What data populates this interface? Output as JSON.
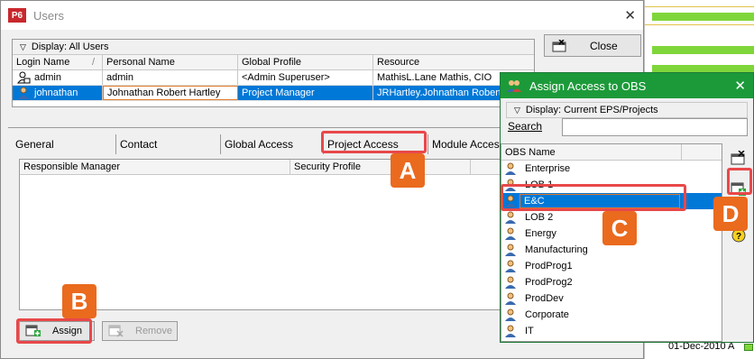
{
  "gantt": {
    "date": "01-Dec-2010 A"
  },
  "users": {
    "title": "Users",
    "app_logo": "P6",
    "close_label": "Close",
    "display_label": "Display: All Users",
    "columns": [
      "Login Name",
      "Personal Name",
      "Global Profile",
      "Resource"
    ],
    "sort_mark": "/",
    "rows": [
      {
        "login": "admin",
        "personal": "admin",
        "profile": "<Admin Superuser>",
        "resource": "MathisL.Lane Mathis, CIO"
      },
      {
        "login": "johnathan",
        "personal": "Johnathan Robert Hartley",
        "profile": "Project Manager",
        "resource": "JRHartley.Johnathan Robert"
      }
    ],
    "tabs": [
      "General",
      "Contact",
      "Global Access",
      "Project Access",
      "Module Acces"
    ],
    "access_columns": [
      "Responsible Manager",
      "Security Profile"
    ],
    "assign_label": "Assign",
    "remove_label": "Remove"
  },
  "obs": {
    "title": "Assign Access to OBS",
    "display_label": "Display: Current EPS/Projects",
    "search_label": "Search",
    "column": "OBS Name",
    "items": [
      "Enterprise",
      "LOB 1",
      "E&C",
      "LOB 2",
      "Energy",
      "Manufacturing",
      "ProdProg1",
      "ProdProg2",
      "ProdDev",
      "Corporate",
      "IT"
    ]
  },
  "callouts": [
    "A",
    "B",
    "C",
    "D"
  ],
  "colors": {
    "highlight": "#e8484a",
    "badge": "#ea6a1e",
    "selection": "#0078d7",
    "obs_title": "#1c9a3a"
  }
}
